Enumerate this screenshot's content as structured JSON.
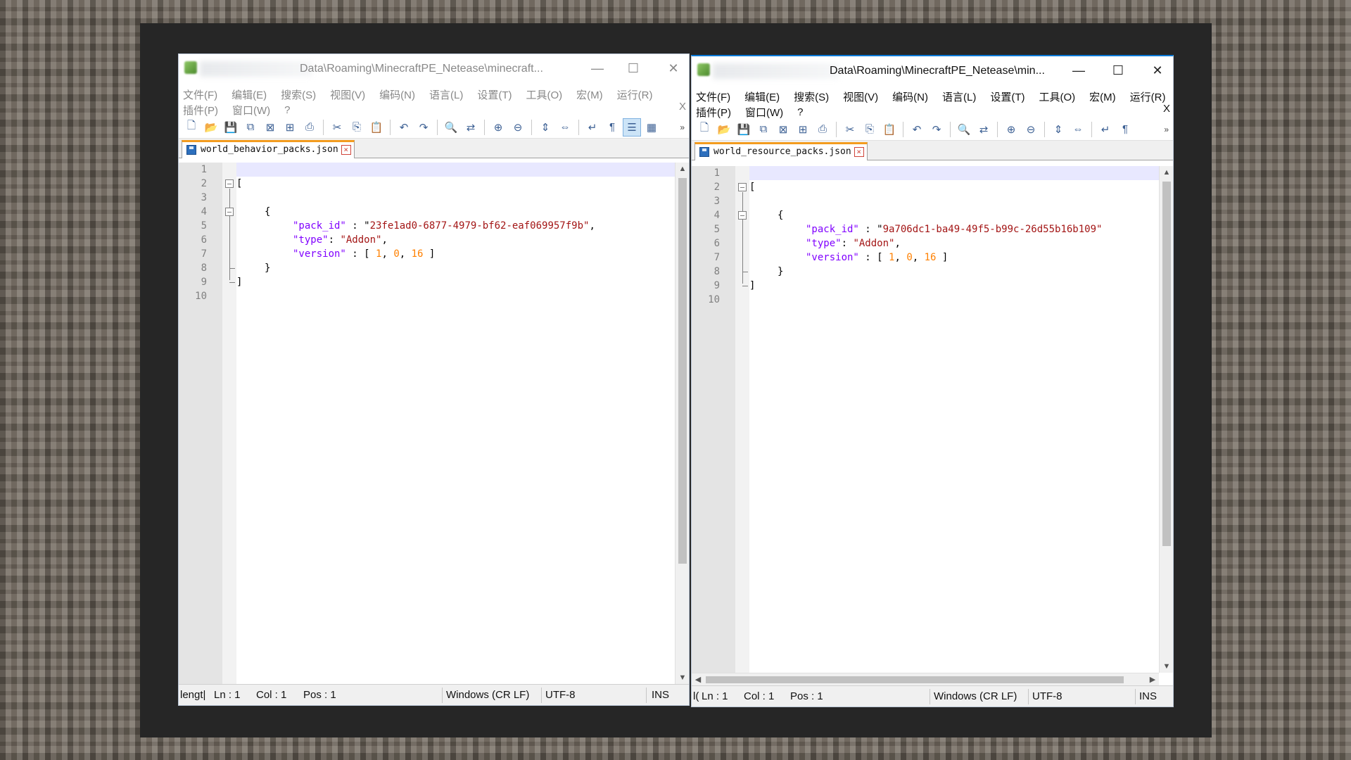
{
  "menu": {
    "row1": [
      "文件(F)",
      "编辑(E)",
      "搜索(S)",
      "视图(V)",
      "编码(N)",
      "语言(L)",
      "设置(T)",
      "工具(O)",
      "宏(M)",
      "运行(R)"
    ],
    "row2": [
      "插件(P)",
      "窗口(W)",
      "?"
    ],
    "close": "X"
  },
  "window_controls": {
    "minimize": "—",
    "maximize": "☐",
    "close": "✕"
  },
  "left": {
    "title": "Data\\Roaming\\MinecraftPE_Netease\\minecraft...",
    "tab": "world_behavior_packs.json",
    "pack_id": "23fe1ad0-6877-4979-bf62-eaf069957f9b",
    "status": {
      "length": "lengt|",
      "ln": "Ln : 1",
      "col": "Col : 1",
      "pos": "Pos : 1",
      "eol": "Windows (CR LF)",
      "encoding": "UTF-8",
      "mode": "INS"
    }
  },
  "right": {
    "title": "Data\\Roaming\\MinecraftPE_Netease\\min...",
    "tab": "world_resource_packs.json",
    "pack_id": "9a706dc1-ba49-49f5-b99c-26d55b16b109",
    "status": {
      "length": "l(",
      "ln": "Ln : 1",
      "col": "Col : 1",
      "pos": "Pos : 1",
      "eol": "Windows (CR LF)",
      "encoding": "UTF-8",
      "mode": "INS"
    }
  },
  "code": {
    "line_numbers": [
      "1",
      "2",
      "3",
      "4",
      "5",
      "6",
      "7",
      "8",
      "9",
      "10"
    ],
    "open_bracket": "[",
    "open_brace": "{",
    "key_pack_id": "\"pack_id\"",
    "key_type": "\"type\"",
    "value_type": "\"Addon\"",
    "key_version": "\"version\"",
    "version_values": [
      "1",
      "0",
      "16"
    ],
    "close_brace": "}",
    "close_bracket": "]"
  },
  "toolbar_icons": [
    "new-file-icon",
    "open-file-icon",
    "save-icon",
    "save-all-icon",
    "close-icon",
    "close-all-icon",
    "print-icon",
    "cut-icon",
    "copy-icon",
    "paste-icon",
    "undo-icon",
    "redo-icon",
    "find-icon",
    "replace-icon",
    "zoom-in-icon",
    "zoom-out-icon",
    "sync-vertical-icon",
    "sync-horizontal-icon",
    "word-wrap-icon",
    "show-all-chars-icon",
    "indent-guide-icon",
    "doc-map-icon"
  ],
  "colors": {
    "key": "#8000ff",
    "string": "#a31515",
    "number": "#ff8000",
    "tab_accent": "#f39c1f",
    "active_border": "#0078d7"
  }
}
